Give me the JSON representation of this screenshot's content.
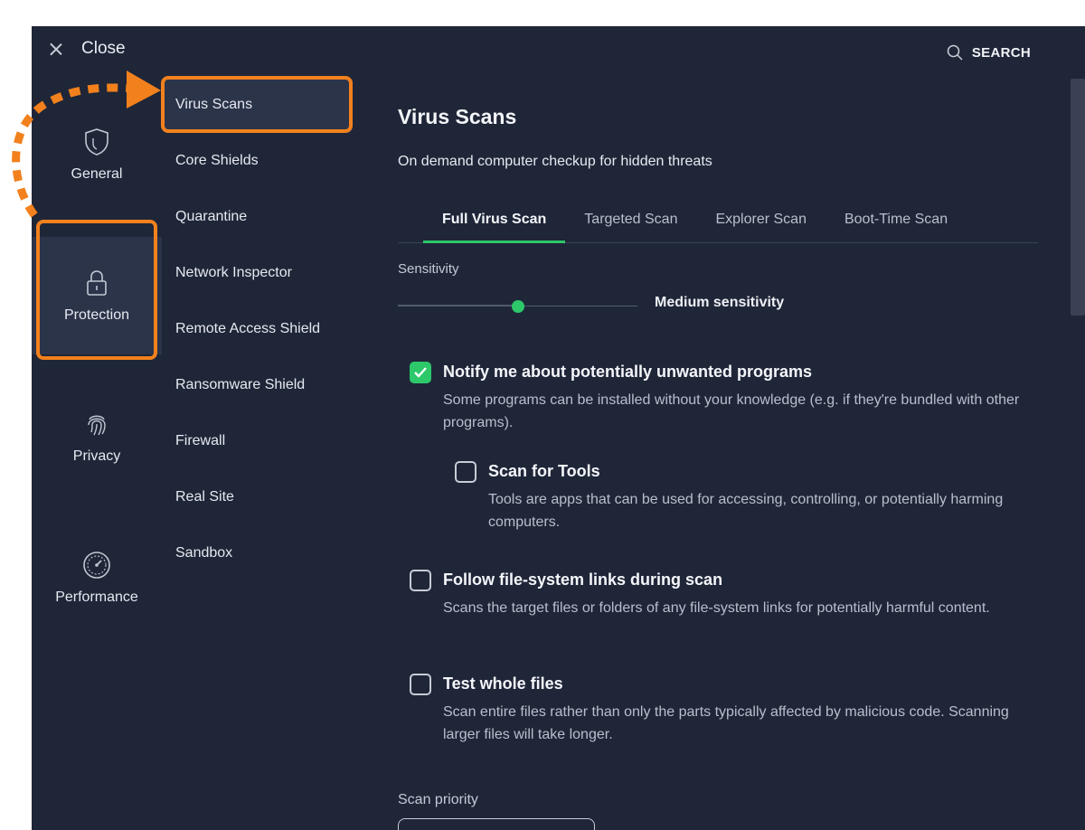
{
  "topbar": {
    "close_label": "Close",
    "search_label": "SEARCH"
  },
  "categories": [
    {
      "label": "General",
      "icon": "shield-icon"
    },
    {
      "label": "Protection",
      "icon": "lock-icon",
      "selected": true
    },
    {
      "label": "Privacy",
      "icon": "fingerprint-icon"
    },
    {
      "label": "Performance",
      "icon": "speedometer-icon"
    }
  ],
  "subnav": {
    "items": [
      "Virus Scans",
      "Core Shields",
      "Quarantine",
      "Network Inspector",
      "Remote Access Shield",
      "Ransomware Shield",
      "Firewall",
      "Real Site",
      "Sandbox"
    ],
    "selected": "Virus Scans"
  },
  "main": {
    "title": "Virus Scans",
    "subtitle": "On demand computer checkup for hidden threats",
    "tabs": [
      "Full Virus Scan",
      "Targeted Scan",
      "Explorer Scan",
      "Boot-Time Scan"
    ],
    "active_tab": "Full Virus Scan",
    "sensitivity": {
      "label": "Sensitivity",
      "value_label": "Medium sensitivity",
      "level": 0.5
    },
    "options": [
      {
        "title": "Notify me about potentially unwanted programs",
        "desc": "Some programs can be installed without your knowledge (e.g. if they're bundled with other programs).",
        "checked": true
      },
      {
        "title": "Scan for Tools",
        "desc": "Tools are apps that can be used for accessing, controlling, or potentially harming computers.",
        "checked": false
      },
      {
        "title": "Follow file-system links during scan",
        "desc": "Scans the target files or folders of any file-system links for potentially harmful content.",
        "checked": false
      },
      {
        "title": "Test whole files",
        "desc": "Scan entire files rather than only the parts typically affected by malicious code. Scanning larger files will take longer.",
        "checked": false
      }
    ],
    "scan_priority_label": "Scan priority"
  },
  "colors": {
    "window_bg": "#1f2638",
    "accent_green": "#2cc86a",
    "highlight_orange": "#f2811d"
  }
}
